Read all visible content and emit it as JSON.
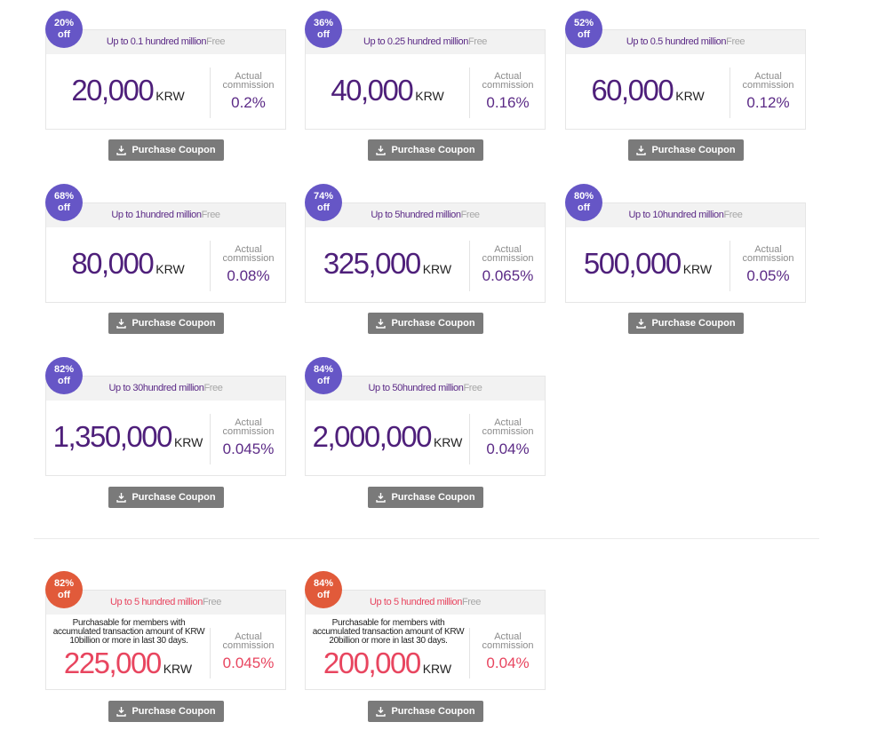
{
  "coupons": [
    {
      "discount": "20%",
      "off": "off",
      "limit": "Up to 0.1 hundred million",
      "free": "Free",
      "price": "20,000",
      "unit": "KRW",
      "comm_label": "Actual commission",
      "comm": "0.2%",
      "button": "Purchase Coupon"
    },
    {
      "discount": "36%",
      "off": "off",
      "limit": "Up to 0.25 hundred million",
      "free": "Free",
      "price": "40,000",
      "unit": "KRW",
      "comm_label": "Actual commission",
      "comm": "0.16%",
      "button": "Purchase Coupon"
    },
    {
      "discount": "52%",
      "off": "off",
      "limit": "Up to 0.5 hundred million",
      "free": "Free",
      "price": "60,000",
      "unit": "KRW",
      "comm_label": "Actual commission",
      "comm": "0.12%",
      "button": "Purchase Coupon"
    },
    {
      "discount": "68%",
      "off": "off",
      "limit": "Up to 1hundred million",
      "free": "Free",
      "price": "80,000",
      "unit": "KRW",
      "comm_label": "Actual commission",
      "comm": "0.08%",
      "button": "Purchase Coupon"
    },
    {
      "discount": "74%",
      "off": "off",
      "limit": "Up to 5hundred million",
      "free": "Free",
      "price": "325,000",
      "unit": "KRW",
      "comm_label": "Actual commission",
      "comm": "0.065%",
      "button": "Purchase Coupon"
    },
    {
      "discount": "80%",
      "off": "off",
      "limit": "Up to 10hundred million",
      "free": "Free",
      "price": "500,000",
      "unit": "KRW",
      "comm_label": "Actual commission",
      "comm": "0.05%",
      "button": "Purchase Coupon"
    },
    {
      "discount": "82%",
      "off": "off",
      "limit": "Up to 30hundred million",
      "free": "Free",
      "price": "1,350,000",
      "unit": "KRW",
      "comm_label": "Actual commission",
      "comm": "0.045%",
      "button": "Purchase Coupon"
    },
    {
      "discount": "84%",
      "off": "off",
      "limit": "Up to 50hundred million",
      "free": "Free",
      "price": "2,000,000",
      "unit": "KRW",
      "comm_label": "Actual commission",
      "comm": "0.04%",
      "button": "Purchase Coupon"
    }
  ],
  "vip_coupons": [
    {
      "discount": "82%",
      "off": "off",
      "limit": "Up to 5 hundred million",
      "free": "Free",
      "note": "Purchasable for members with accumulated transaction amount of KRW 10billion or more in last 30 days.",
      "price": "225,000",
      "unit": "KRW",
      "comm_label": "Actual commission",
      "comm": "0.045%",
      "button": "Purchase Coupon"
    },
    {
      "discount": "84%",
      "off": "off",
      "limit": "Up to 5 hundred million",
      "free": "Free",
      "note": "Purchasable for members with accumulated transaction amount of KRW 20billion or more in last 30 days.",
      "price": "200,000",
      "unit": "KRW",
      "comm_label": "Actual commission",
      "comm": "0.04%",
      "button": "Purchase Coupon"
    }
  ],
  "icons": {
    "button_icon": "download-icon"
  },
  "colors": {
    "badge": "#6656c6",
    "vip_badge": "#e15a3a",
    "price": "#4e1f7a",
    "vip_price": "#e8455f",
    "button": "#7a7a7a"
  }
}
